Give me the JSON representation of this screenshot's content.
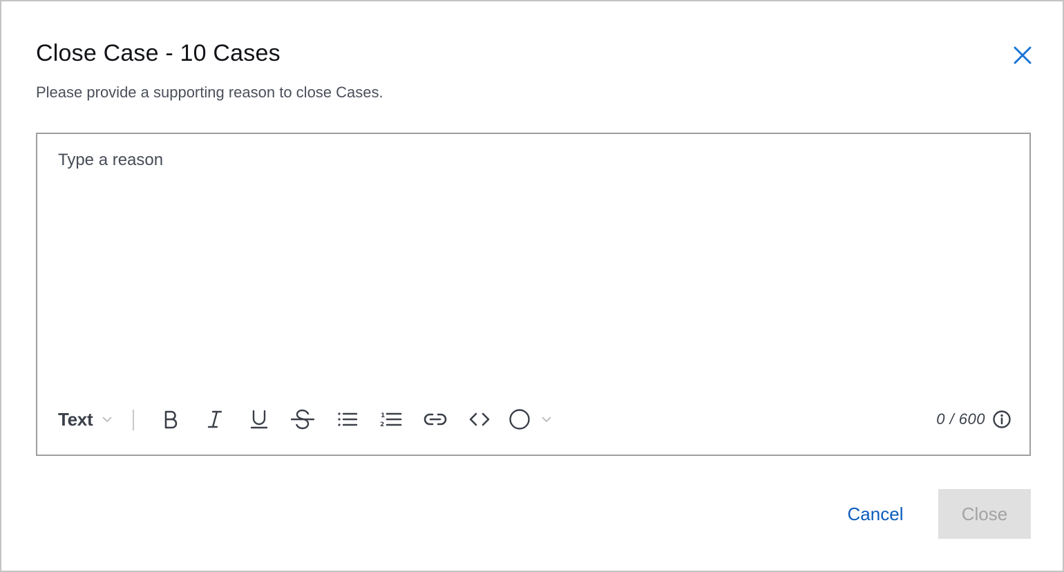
{
  "dialog": {
    "title": "Close Case - 10 Cases",
    "subtitle": "Please provide a supporting reason to close Cases.",
    "close_icon": "close-icon",
    "accent_color": "#0b5cbd"
  },
  "editor": {
    "value": "",
    "placeholder": "Type a reason",
    "toolbar": {
      "text_style_label": "Text",
      "buttons": [
        {
          "name": "bold",
          "icon": "bold-icon"
        },
        {
          "name": "italic",
          "icon": "italic-icon"
        },
        {
          "name": "underline",
          "icon": "underline-icon"
        },
        {
          "name": "strikethrough",
          "icon": "strikethrough-icon"
        },
        {
          "name": "bulleted-list",
          "icon": "bulleted-list-icon"
        },
        {
          "name": "numbered-list",
          "icon": "numbered-list-icon"
        },
        {
          "name": "link",
          "icon": "link-icon"
        },
        {
          "name": "code",
          "icon": "code-icon"
        },
        {
          "name": "color",
          "icon": "circle-icon"
        }
      ]
    },
    "char_count": "0 / 600",
    "char_count_info_icon": "info-icon"
  },
  "footer": {
    "cancel_label": "Cancel",
    "close_label": "Close",
    "close_disabled": true
  }
}
